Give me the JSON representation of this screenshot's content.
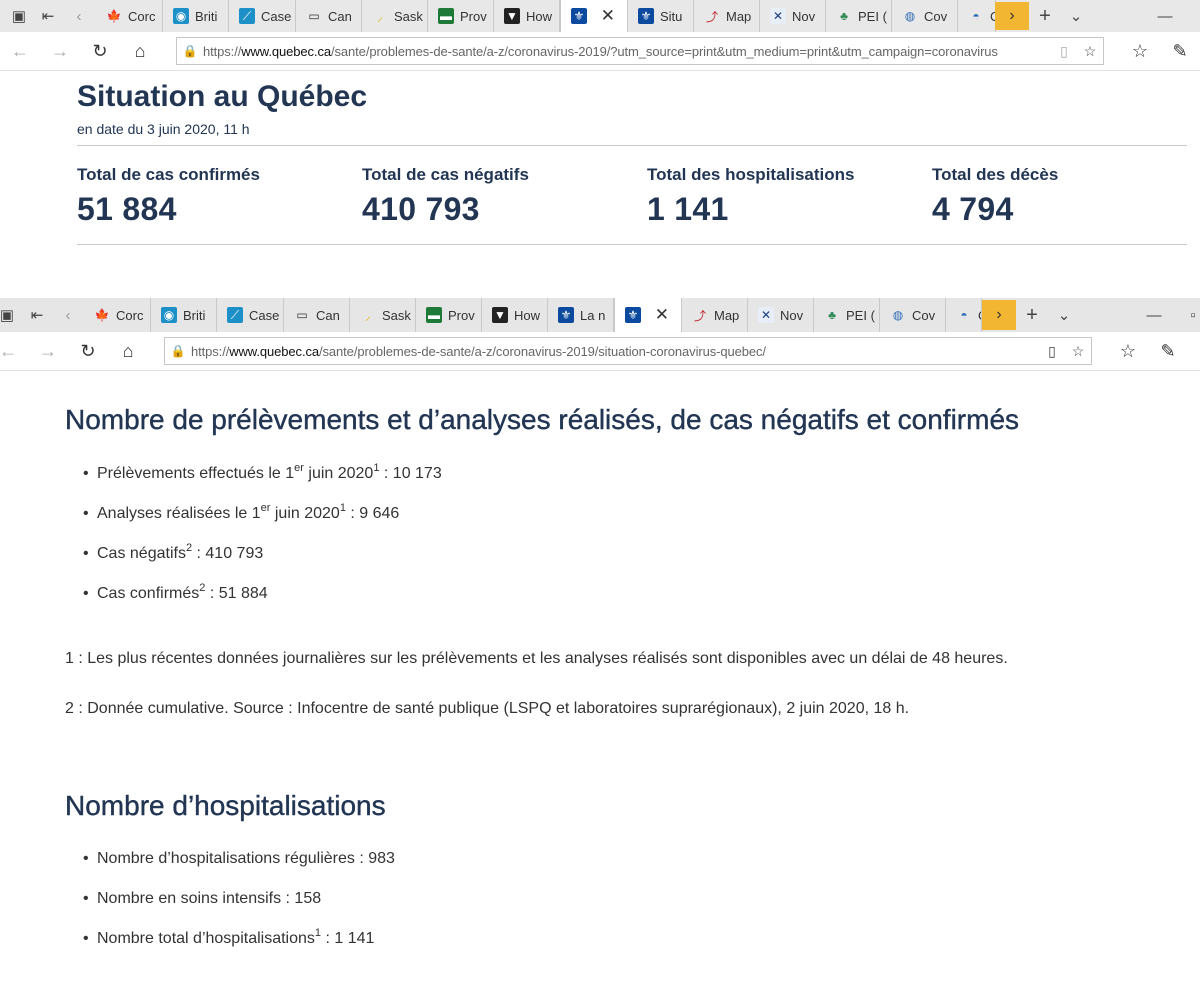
{
  "browser1": {
    "tabs": [
      {
        "label": "Corc",
        "icon": "maple-leaf-icon",
        "active": false
      },
      {
        "label": "Briti",
        "icon": "bc-icon",
        "active": false
      },
      {
        "label": "Case",
        "icon": "chart-icon",
        "active": false
      },
      {
        "label": "Can",
        "icon": "window-icon",
        "active": false
      },
      {
        "label": "Sask",
        "icon": "sask-icon",
        "active": false
      },
      {
        "label": "Prov",
        "icon": "green-flag-icon",
        "active": false
      },
      {
        "label": "How",
        "icon": "shield-icon",
        "active": false
      },
      {
        "label": "",
        "icon": "fleur-de-lis-icon",
        "active": true
      },
      {
        "label": "Situ",
        "icon": "fleur-de-lis-icon",
        "active": false
      },
      {
        "label": "Map",
        "icon": "map-icon",
        "active": false
      },
      {
        "label": "Nov",
        "icon": "nova-scotia-icon",
        "active": false
      },
      {
        "label": "PEI (",
        "icon": "pei-icon",
        "active": false
      },
      {
        "label": "Cov",
        "icon": "globe-icon",
        "active": false
      },
      {
        "label": "C",
        "icon": "nl-icon",
        "active": false
      }
    ],
    "url_prefix": "https://",
    "url_domain": "www.quebec.ca",
    "url_rest": "/sante/problemes-de-sante/a-z/coronavirus-2019/?utm_source=print&utm_medium=print&utm_campaign=coronavirus"
  },
  "browser2": {
    "tabs": [
      {
        "label": "Corc",
        "icon": "maple-leaf-icon",
        "active": false
      },
      {
        "label": "Briti",
        "icon": "bc-icon",
        "active": false
      },
      {
        "label": "Case",
        "icon": "chart-icon",
        "active": false
      },
      {
        "label": "Can",
        "icon": "window-icon",
        "active": false
      },
      {
        "label": "Sask",
        "icon": "sask-icon",
        "active": false
      },
      {
        "label": "Prov",
        "icon": "green-flag-icon",
        "active": false
      },
      {
        "label": "How",
        "icon": "shield-icon",
        "active": false
      },
      {
        "label": "La n",
        "icon": "fleur-de-lis-icon",
        "active": false
      },
      {
        "label": "",
        "icon": "fleur-de-lis-icon",
        "active": true
      },
      {
        "label": "Map",
        "icon": "map-icon",
        "active": false
      },
      {
        "label": "Nov",
        "icon": "nova-scotia-icon",
        "active": false
      },
      {
        "label": "PEI (",
        "icon": "pei-icon",
        "active": false
      },
      {
        "label": "Cov",
        "icon": "globe-icon",
        "active": false
      },
      {
        "label": "C",
        "icon": "nl-icon",
        "active": false
      }
    ],
    "url_prefix": "https://",
    "url_domain": "www.quebec.ca",
    "url_rest": "/sante/problemes-de-sante/a-z/coronavirus-2019/situation-coronavirus-quebec/"
  },
  "situation": {
    "title": "Situation au Québec",
    "date": "en date du 3 juin 2020, 11 h",
    "stats": [
      {
        "label": "Total de cas confirmés",
        "value": "51 884"
      },
      {
        "label": "Total de cas négatifs",
        "value": "410 793"
      },
      {
        "label": "Total des hospitalisations",
        "value": "1 141"
      },
      {
        "label": "Total des décès",
        "value": "4 794"
      }
    ]
  },
  "tests": {
    "heading": "Nombre de prélèvements et d’analyses réalisés, de cas négatifs et confirmés",
    "items": [
      {
        "parts": [
          "Prélèvements effectués le 1",
          {
            "sup": "er"
          },
          " juin 2020",
          {
            "sup": "1"
          },
          " : 10 173"
        ]
      },
      {
        "parts": [
          "Analyses réalisées le 1",
          {
            "sup": "er"
          },
          " juin 2020",
          {
            "sup": "1"
          },
          " : 9 646"
        ]
      },
      {
        "parts": [
          "Cas négatifs",
          {
            "sup": "2"
          },
          " : 410 793"
        ]
      },
      {
        "parts": [
          "Cas confirmés",
          {
            "sup": "2"
          },
          " : 51 884"
        ]
      }
    ],
    "notes": [
      "1 : Les plus récentes données journalières sur les prélèvements et les analyses réalisés sont disponibles avec un délai de 48 heures.",
      "2 : Donnée cumulative. Source : Infocentre de santé publique (LSPQ et laboratoires suprarégionaux), 2 juin 2020, 18 h."
    ]
  },
  "hospital": {
    "heading": "Nombre d’hospitalisations",
    "items": [
      {
        "parts": [
          "Nombre d’hospitalisations régulières : 983"
        ]
      },
      {
        "parts": [
          "Nombre en soins intensifs : 158"
        ]
      },
      {
        "parts": [
          "Nombre total d’hospitalisations",
          {
            "sup": "1"
          },
          " : 1 141"
        ]
      }
    ]
  },
  "icons": {
    "maple-leaf-icon": {
      "glyph": "🍁",
      "color": "#d52b1e",
      "bg": "transparent"
    },
    "bc-icon": {
      "glyph": "◉",
      "color": "#ffffff",
      "bg": "#1e90c8"
    },
    "chart-icon": {
      "glyph": "⟋",
      "color": "#ffffff",
      "bg": "#1e90c8"
    },
    "window-icon": {
      "glyph": "▭",
      "color": "#333333",
      "bg": "transparent"
    },
    "sask-icon": {
      "glyph": "⸝",
      "color": "#e4b400",
      "bg": "transparent"
    },
    "green-flag-icon": {
      "glyph": "▬",
      "color": "#ffffff",
      "bg": "#1f7a3a"
    },
    "shield-icon": {
      "glyph": "▼",
      "color": "#ffffff",
      "bg": "#222222"
    },
    "fleur-de-lis-icon": {
      "glyph": "⚜",
      "color": "#ffffff",
      "bg": "#0b4a9e"
    },
    "map-icon": {
      "glyph": "⤴",
      "color": "#c0282e",
      "bg": "transparent"
    },
    "nova-scotia-icon": {
      "glyph": "✕",
      "color": "#1a3d7a",
      "bg": "#e8eef8"
    },
    "pei-icon": {
      "glyph": "♣",
      "color": "#2e8b57",
      "bg": "transparent"
    },
    "globe-icon": {
      "glyph": "◍",
      "color": "#2f6db5",
      "bg": "transparent"
    },
    "nl-icon": {
      "glyph": "◓",
      "color": "#2c6fb5",
      "bg": "transparent"
    }
  }
}
